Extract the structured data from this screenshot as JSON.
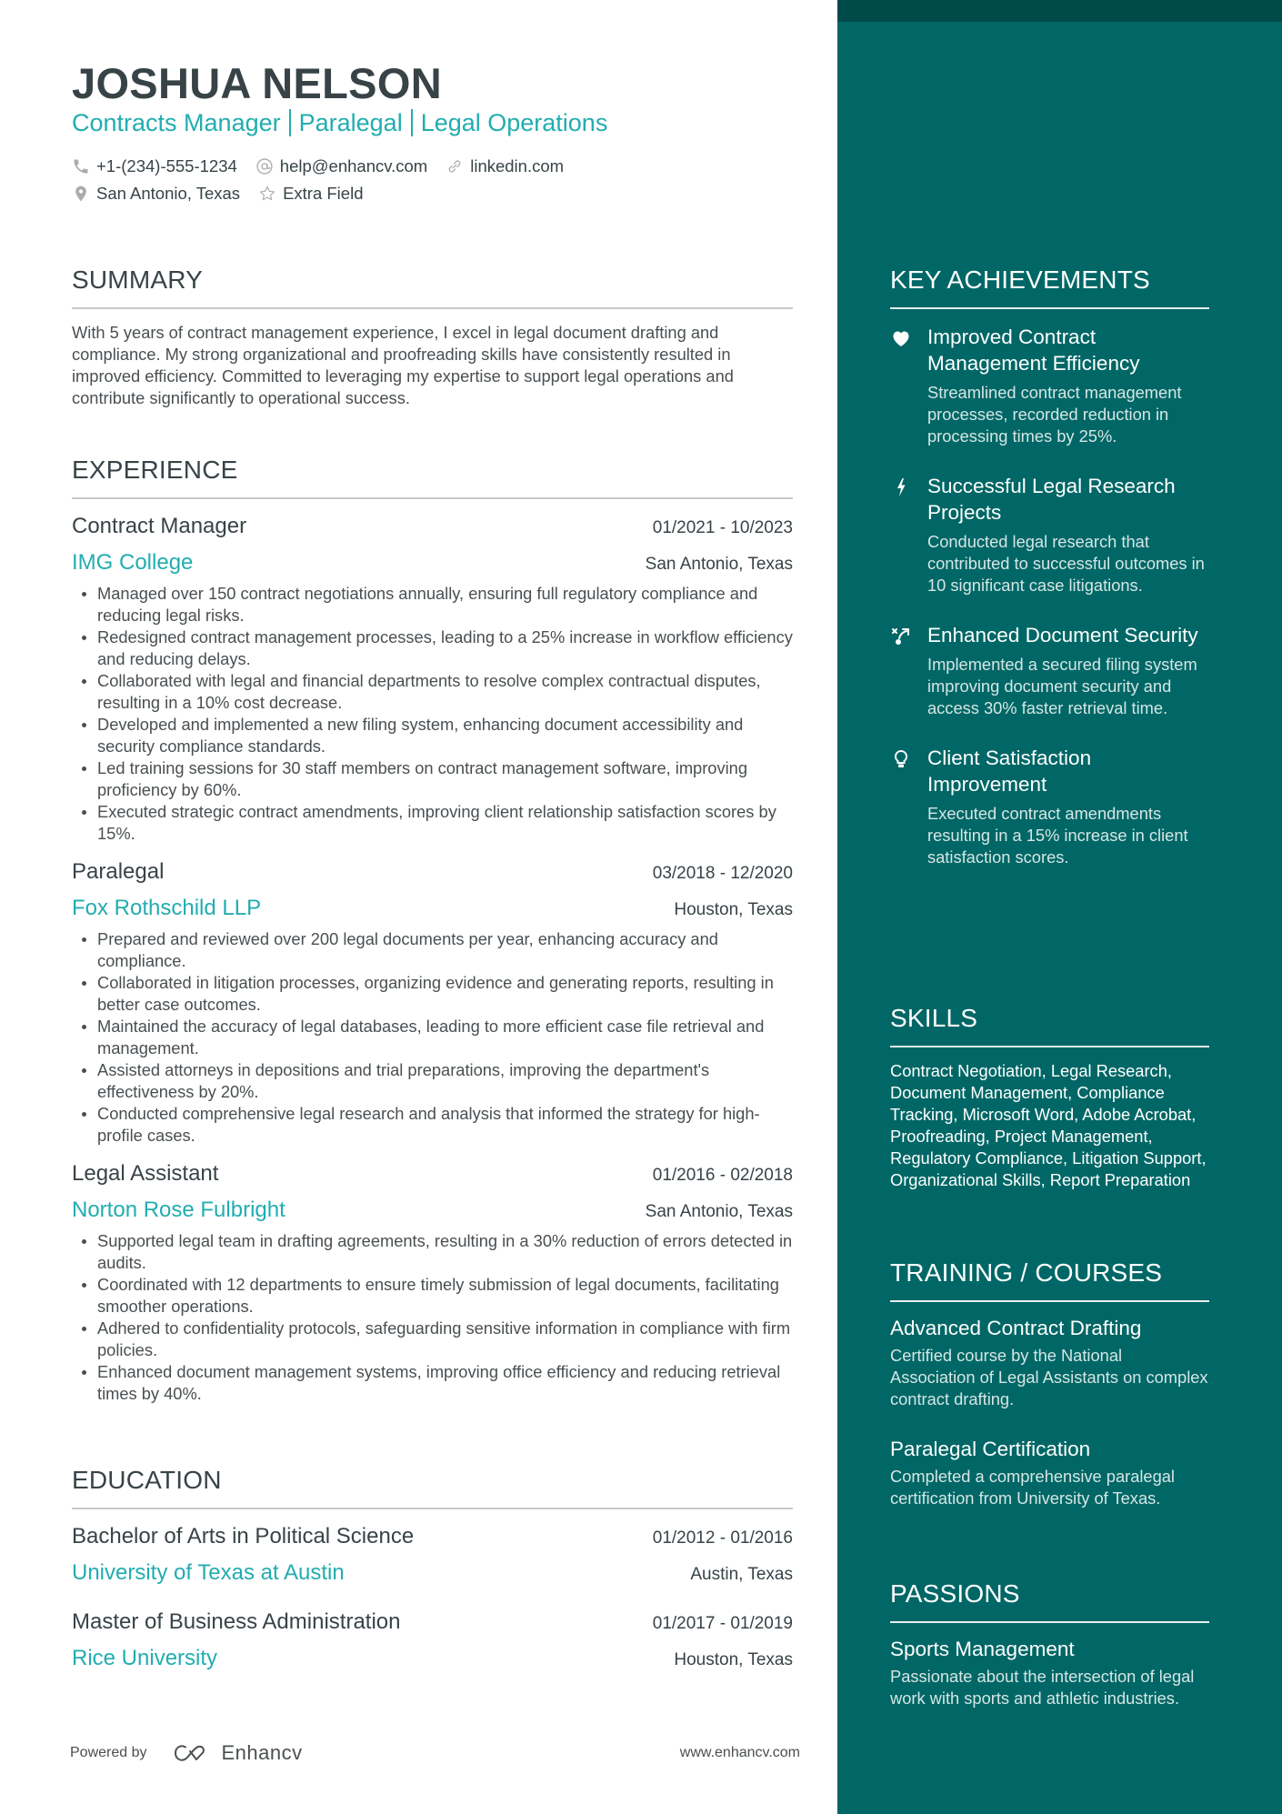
{
  "header": {
    "name": "JOSHUA NELSON",
    "titles": [
      "Contracts Manager",
      "Paralegal",
      "Legal Operations"
    ],
    "contacts_row1": [
      {
        "icon": "phone-icon",
        "text": "+1-(234)-555-1234"
      },
      {
        "icon": "at-icon",
        "text": "help@enhancv.com"
      },
      {
        "icon": "link-icon",
        "text": "linkedin.com"
      }
    ],
    "contacts_row2": [
      {
        "icon": "location-pin-icon",
        "text": "San Antonio, Texas"
      },
      {
        "icon": "star-icon",
        "text": "Extra Field"
      }
    ]
  },
  "summary": {
    "heading": "SUMMARY",
    "text": "With 5 years of contract management experience, I excel in legal document drafting and compliance. My strong organizational and proofreading skills have consistently resulted in improved efficiency. Committed to leveraging my expertise to support legal operations and contribute significantly to operational success."
  },
  "experience": {
    "heading": "EXPERIENCE",
    "jobs": [
      {
        "title": "Contract Manager",
        "dates": "01/2021 - 10/2023",
        "company": "IMG College",
        "location": "San Antonio, Texas",
        "bullets": [
          "Managed over 150 contract negotiations annually, ensuring full regulatory compliance and reducing legal risks.",
          "Redesigned contract management processes, leading to a 25% increase in workflow efficiency and reducing delays.",
          "Collaborated with legal and financial departments to resolve complex contractual disputes, resulting in a 10% cost decrease.",
          "Developed and implemented a new filing system, enhancing document accessibility and security compliance standards.",
          "Led training sessions for 30 staff members on contract management software, improving proficiency by 60%.",
          "Executed strategic contract amendments, improving client relationship satisfaction scores by 15%."
        ]
      },
      {
        "title": "Paralegal",
        "dates": "03/2018 - 12/2020",
        "company": "Fox Rothschild LLP",
        "location": "Houston, Texas",
        "bullets": [
          "Prepared and reviewed over 200 legal documents per year, enhancing accuracy and compliance.",
          "Collaborated in litigation processes, organizing evidence and generating reports, resulting in better case outcomes.",
          "Maintained the accuracy of legal databases, leading to more efficient case file retrieval and management.",
          "Assisted attorneys in depositions and trial preparations, improving the department's effectiveness by 20%.",
          "Conducted comprehensive legal research and analysis that informed the strategy for high-profile cases."
        ]
      },
      {
        "title": "Legal Assistant",
        "dates": "01/2016 - 02/2018",
        "company": "Norton Rose Fulbright",
        "location": "San Antonio, Texas",
        "bullets": [
          "Supported legal team in drafting agreements, resulting in a 30% reduction of errors detected in audits.",
          "Coordinated with 12 departments to ensure timely submission of legal documents, facilitating smoother operations.",
          "Adhered to confidentiality protocols, safeguarding sensitive information in compliance with firm policies.",
          "Enhanced document management systems, improving office efficiency and reducing retrieval times by 40%."
        ]
      }
    ]
  },
  "education": {
    "heading": "EDUCATION",
    "items": [
      {
        "degree": "Bachelor of Arts in Political Science",
        "dates": "01/2012 - 01/2016",
        "school": "University of Texas at Austin",
        "location": "Austin, Texas"
      },
      {
        "degree": "Master of Business Administration",
        "dates": "01/2017 - 01/2019",
        "school": "Rice University",
        "location": "Houston, Texas"
      }
    ]
  },
  "footer": {
    "powered_by": "Powered by",
    "brand": "Enhancv",
    "website": "www.enhancv.com"
  },
  "achievements": {
    "heading": "KEY ACHIEVEMENTS",
    "items": [
      {
        "icon": "heart-icon",
        "title": "Improved Contract Management Efficiency",
        "description": "Streamlined contract management processes, recorded reduction in processing times by 25%."
      },
      {
        "icon": "lightning-bolt-icon",
        "title": "Successful Legal Research Projects",
        "description": "Conducted legal research that contributed to successful outcomes in 10 significant case litigations."
      },
      {
        "icon": "strategy-play-icon",
        "title": "Enhanced Document Security",
        "description": "Implemented a secured filing system improving document security and access 30% faster retrieval time."
      },
      {
        "icon": "lightbulb-icon",
        "title": "Client Satisfaction Improvement",
        "description": "Executed contract amendments resulting in a 15% increase in client satisfaction scores."
      }
    ]
  },
  "skills": {
    "heading": "SKILLS",
    "text": "Contract Negotiation, Legal Research, Document Management, Compliance Tracking, Microsoft Word, Adobe Acrobat, Proofreading, Project Management, Regulatory Compliance, Litigation Support, Organizational Skills, Report Preparation"
  },
  "training": {
    "heading": "TRAINING / COURSES",
    "items": [
      {
        "title": "Advanced Contract Drafting",
        "description": "Certified course by the National Association of Legal Assistants on complex contract drafting."
      },
      {
        "title": "Paralegal Certification",
        "description": "Completed a comprehensive paralegal certification from University of Texas."
      }
    ]
  },
  "passions": {
    "heading": "PASSIONS",
    "items": [
      {
        "title": "Sports Management",
        "description": "Passionate about the intersection of legal work with sports and athletic industries."
      }
    ]
  },
  "colors": {
    "accent": "#22adb0",
    "sidebar": "#006766",
    "sidebar_top": "#004a4a",
    "text": "#384347"
  }
}
